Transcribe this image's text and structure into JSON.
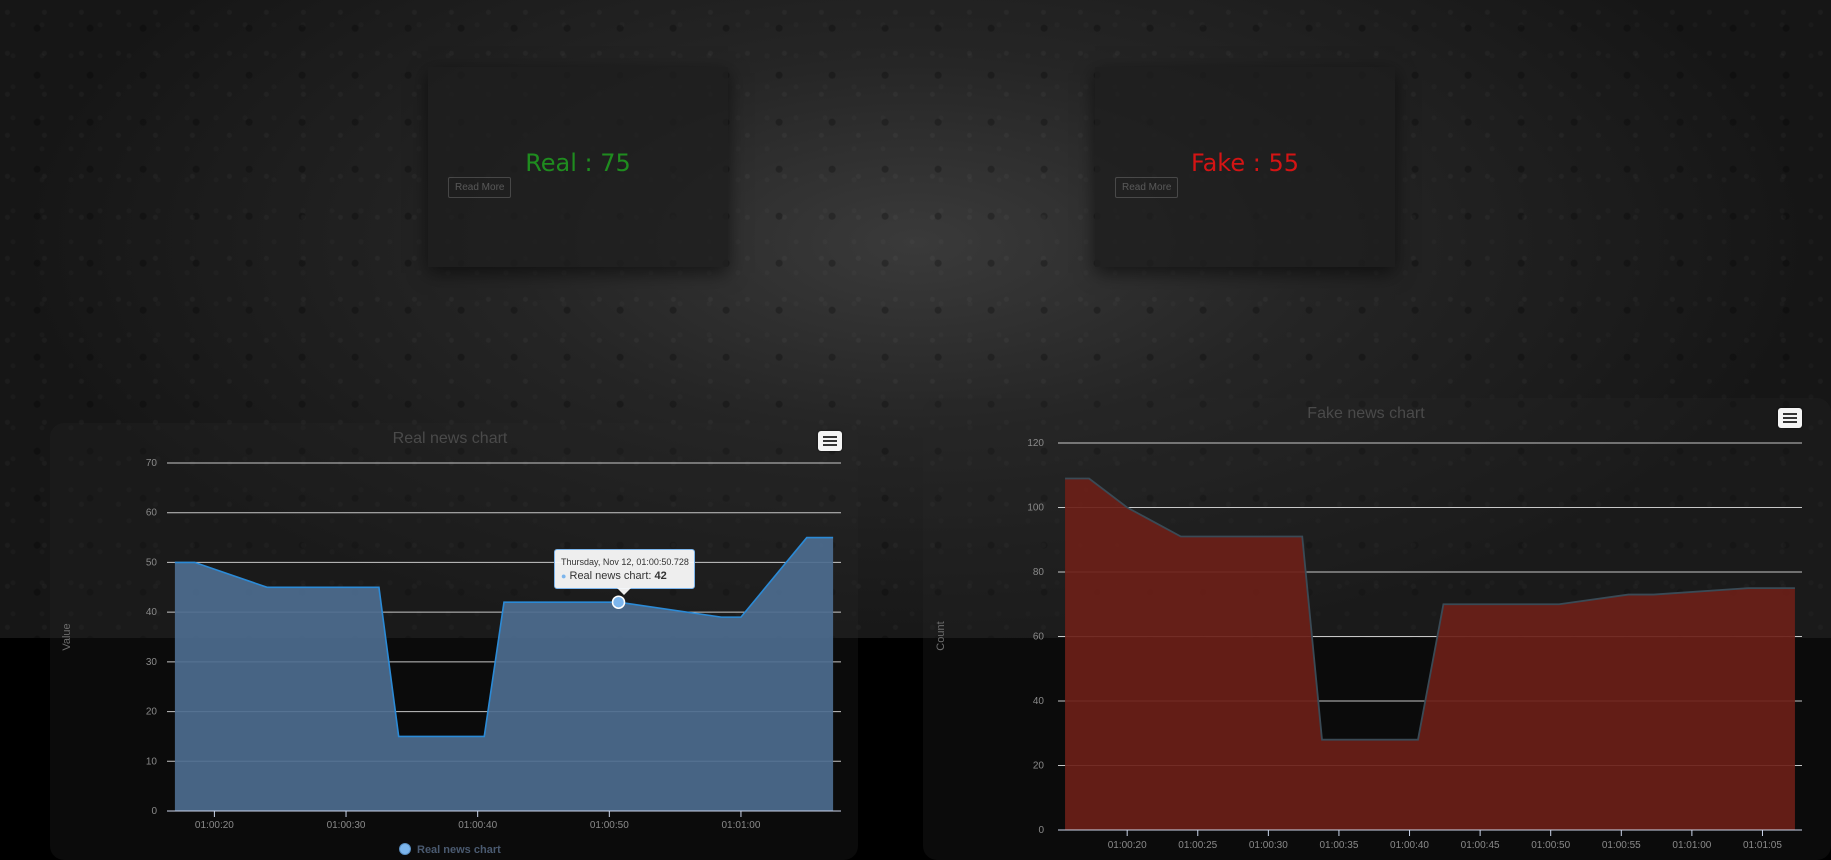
{
  "cards": {
    "real": {
      "label": "Real : 75",
      "read_more": "Read More"
    },
    "fake": {
      "label": "Fake : 55",
      "read_more": "Read More"
    }
  },
  "colors": {
    "real_fill": "#4d6d8f",
    "real_line": "#2b8ad6",
    "fake_fill": "#6b2018",
    "fake_line": "#3a4a55",
    "real_text": "#1f8c1f",
    "fake_text": "#d41414"
  },
  "icons": {
    "menu": "hamburger-menu-icon"
  },
  "tooltip": {
    "date": "Thursday, Nov 12, 01:00:50.728",
    "series": "Real news chart",
    "value": "42"
  },
  "chart_data": [
    {
      "type": "area",
      "title": "Real news chart",
      "xlabel": "",
      "ylabel": "Value",
      "ylim": [
        0,
        70
      ],
      "yticks": [
        0,
        10,
        20,
        30,
        40,
        50,
        60,
        70
      ],
      "xlim": [
        "01:00:16.4",
        "01:01:07.6"
      ],
      "xticks": [
        "01:00:20",
        "01:00:30",
        "01:00:40",
        "01:00:50",
        "01:01:00"
      ],
      "grid": true,
      "legend": "bottom-center",
      "series": [
        {
          "name": "Real news chart",
          "x": [
            "01:00:17",
            "01:00:18.5",
            "01:00:24",
            "01:00:27",
            "01:00:32.5",
            "01:00:34",
            "01:00:40.5",
            "01:00:42",
            "01:00:50.7",
            "01:00:58.5",
            "01:01:00",
            "01:01:05",
            "01:01:07"
          ],
          "y": [
            50,
            50,
            45,
            45,
            45,
            15,
            15,
            42,
            42,
            39,
            39,
            55,
            55
          ]
        }
      ]
    },
    {
      "type": "area",
      "title": "Fake news chart",
      "xlabel": "",
      "ylabel": "Count",
      "ylim": [
        0,
        120
      ],
      "yticks": [
        0,
        20,
        40,
        60,
        80,
        100,
        120
      ],
      "xlim": [
        "01:00:15.1",
        "01:01:07.8"
      ],
      "xticks": [
        "01:00:20",
        "01:00:25",
        "01:00:30",
        "01:00:35",
        "01:00:40",
        "01:00:45",
        "01:00:50",
        "01:00:55",
        "01:01:00",
        "01:01:05"
      ],
      "grid": true,
      "legend": "none",
      "series": [
        {
          "name": "Fake news chart",
          "x": [
            "01:00:15.6",
            "01:00:17.3",
            "01:00:20",
            "01:00:23.8",
            "01:00:30",
            "01:00:32.4",
            "01:00:33.8",
            "01:00:40.6",
            "01:00:42.4",
            "01:00:50.6",
            "01:00:55.5",
            "01:00:57.3",
            "01:01:04",
            "01:01:07.3"
          ],
          "y": [
            109,
            109,
            100,
            91,
            91,
            91,
            28,
            28,
            70,
            70,
            73,
            73,
            75,
            75
          ]
        }
      ]
    }
  ]
}
